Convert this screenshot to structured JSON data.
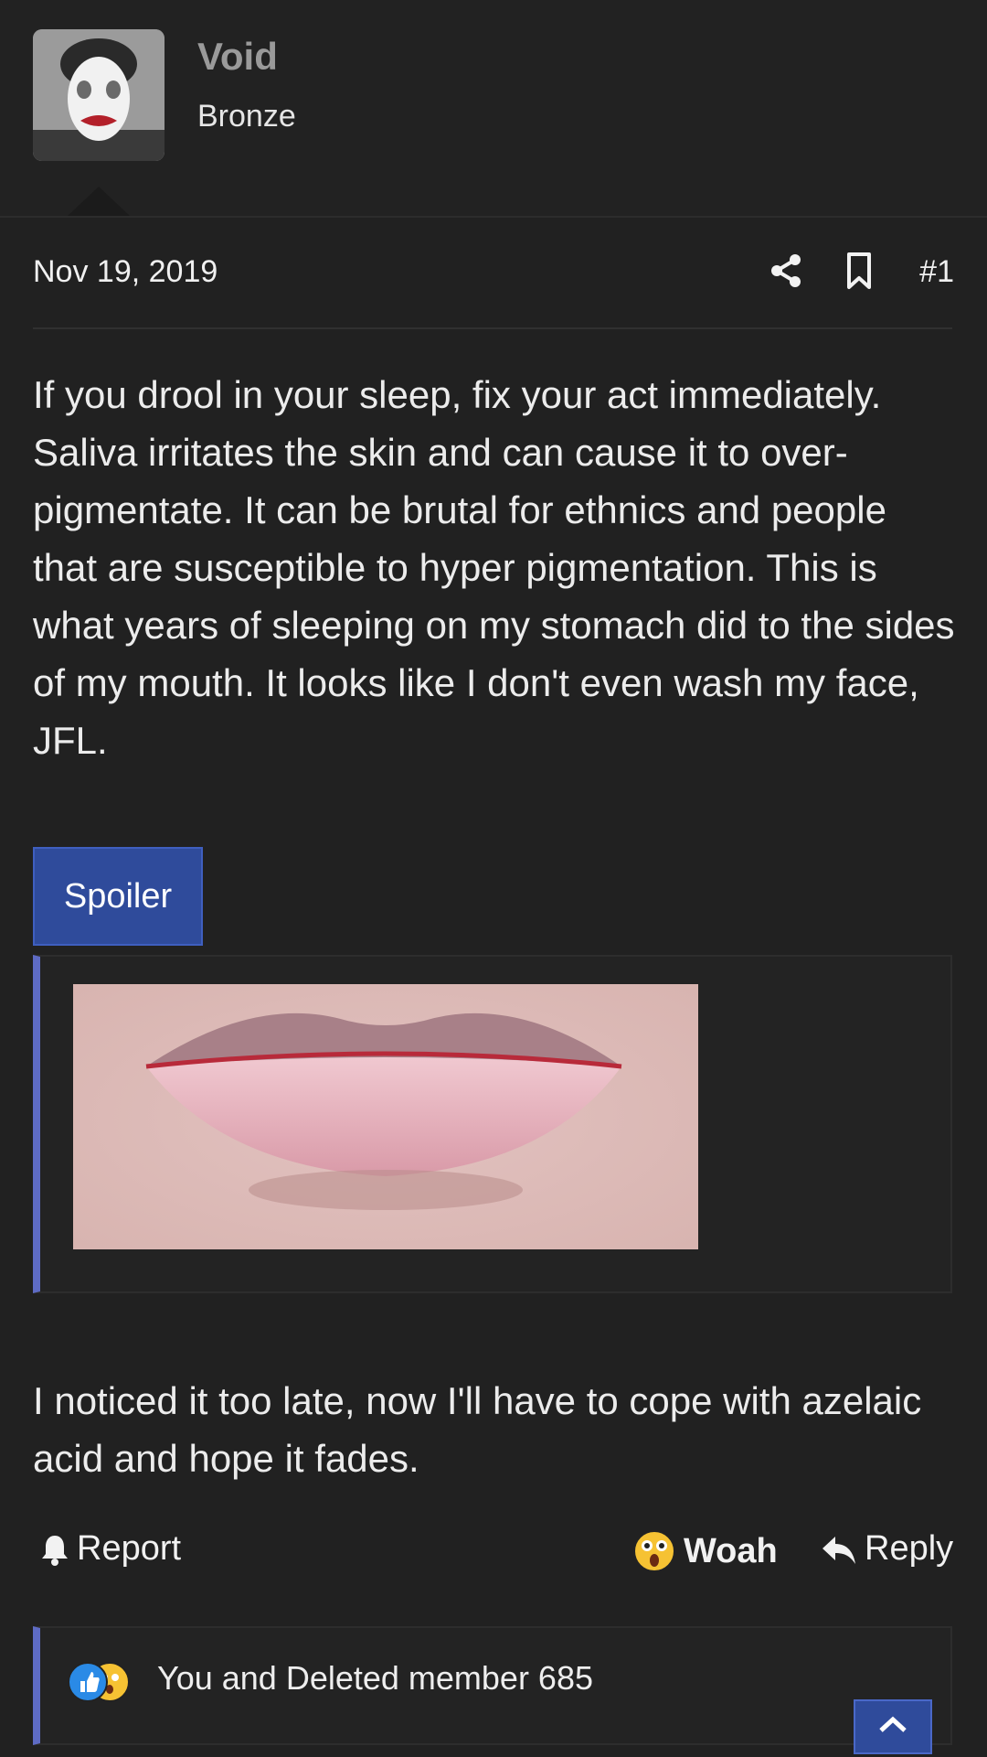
{
  "user": {
    "name": "Void",
    "rank": "Bronze"
  },
  "post": {
    "date": "Nov 19, 2019",
    "number": "#1",
    "paragraph1": "If you drool in your sleep, fix your act immediately. Saliva irritates the skin and can cause it to over-pigmentate. It can be brutal for ethnics and people that are susceptible to hyper pigmentation. This is what years of sleeping on my stomach did to the sides of my mouth. It looks like I don't even wash my face, JFL.",
    "spoiler_label": "Spoiler",
    "paragraph2": "I noticed it too late, now I'll have to cope with azelaic acid and hope it fades."
  },
  "actions": {
    "report": "Report",
    "reaction": "Woah",
    "reply": "Reply"
  },
  "reactions": {
    "summary": "You and Deleted member 685"
  },
  "icons": {
    "share": "share-icon",
    "bookmark": "bookmark-icon",
    "report": "bell-icon",
    "reaction": "woah-emoji-icon",
    "reply": "reply-arrow-icon",
    "like": "thumbs-up-icon",
    "scroll_top": "chevron-up-icon"
  },
  "colors": {
    "background": "#212121",
    "accent": "#2f4b9b",
    "quote_border": "#5e6bc4"
  }
}
